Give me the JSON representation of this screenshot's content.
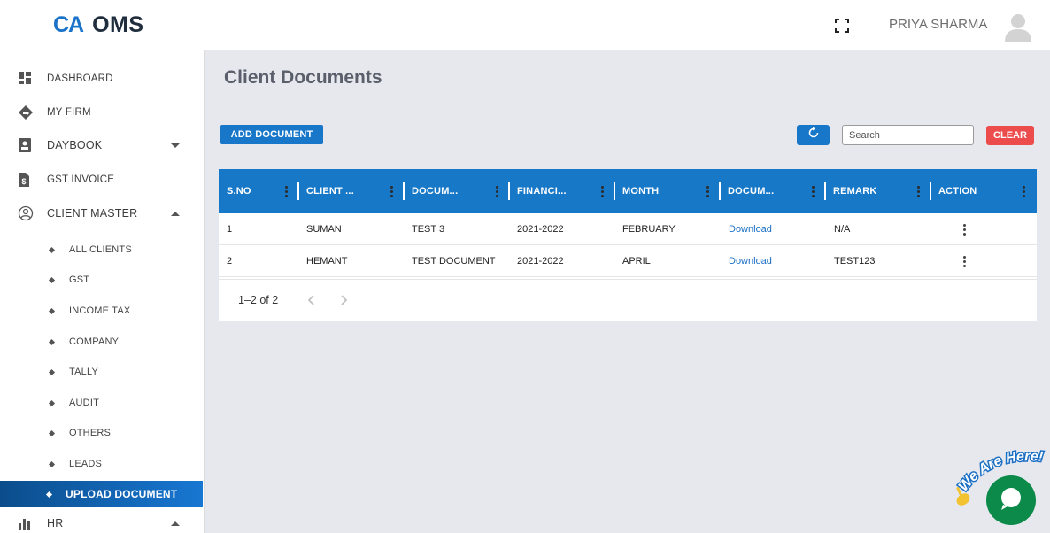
{
  "header": {
    "logo_mark": "CA",
    "logo_text": "OMS",
    "user_name": "PRIYA SHARMA"
  },
  "sidebar": {
    "items": [
      {
        "label": "DASHBOARD",
        "icon": "dashboard-icon"
      },
      {
        "label": "MY FIRM",
        "icon": "firm-icon"
      },
      {
        "label": "DAYBOOK",
        "icon": "daybook-icon",
        "expandable": true,
        "expanded": false
      },
      {
        "label": "GST INVOICE",
        "icon": "invoice-icon"
      },
      {
        "label": "CLIENT MASTER",
        "icon": "client-master-icon",
        "expandable": true,
        "expanded": true
      },
      {
        "label": "HR",
        "icon": "hr-chart-icon",
        "expandable": true,
        "expanded": true
      }
    ],
    "sub_items": [
      {
        "label": "ALL CLIENTS"
      },
      {
        "label": "GST"
      },
      {
        "label": "INCOME TAX"
      },
      {
        "label": "COMPANY"
      },
      {
        "label": "TALLY"
      },
      {
        "label": "AUDIT"
      },
      {
        "label": "OTHERS"
      },
      {
        "label": "LEADS"
      },
      {
        "label": "UPLOAD DOCUMENT",
        "active": true
      }
    ]
  },
  "main": {
    "title": "Client Documents",
    "add_button": "ADD DOCUMENT",
    "search_placeholder": "Search",
    "clear_button": "CLEAR",
    "accent_color": "#1878c8",
    "clear_color": "#ec4c4c"
  },
  "table": {
    "columns": [
      "S.NO",
      "CLIENT ...",
      "DOCUM...",
      "FINANCI...",
      "MONTH",
      "DOCUM...",
      "REMARK",
      "ACTION"
    ],
    "rows": [
      [
        "1",
        "SUMAN",
        "TEST 3",
        "2021-2022",
        "FEBRUARY",
        "Download",
        "N/A"
      ],
      [
        "2",
        "HEMANT",
        "TEST DOCUMENT",
        "2021-2022",
        "APRIL",
        "Download",
        "TEST123"
      ]
    ],
    "pagination": "1–2 of 2"
  },
  "chat": {
    "sign_text": "We Are Here!",
    "button_color": "#0b8a4a"
  }
}
